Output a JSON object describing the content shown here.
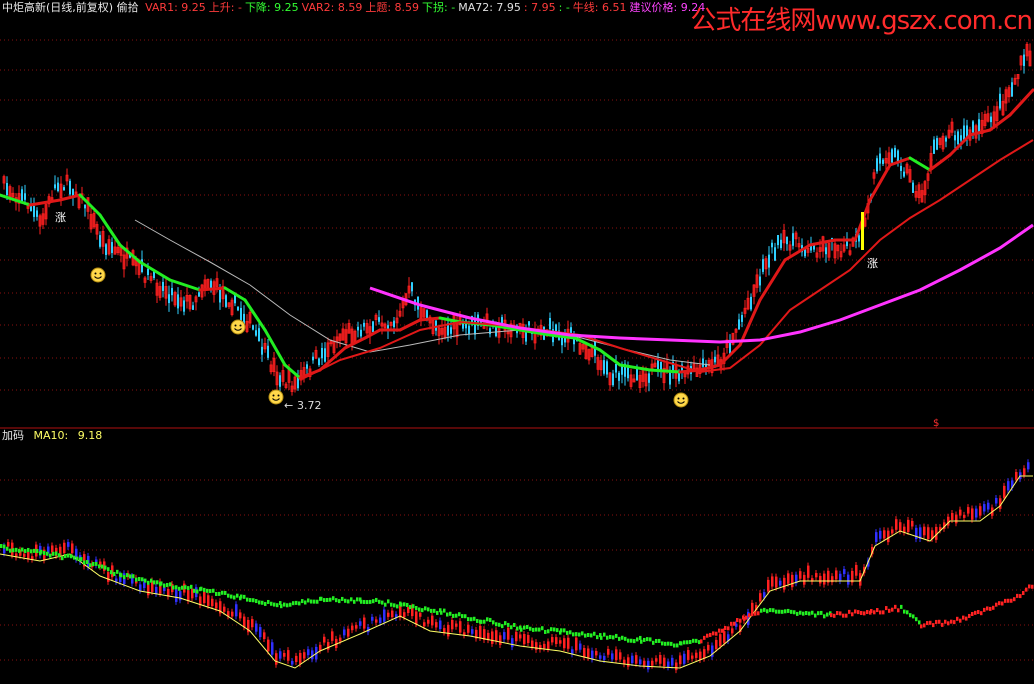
{
  "header": {
    "title": "中炬高新(日线,前复权) 偷拾",
    "fields": [
      {
        "label": "VAR1:",
        "value": "9.25",
        "color": "#ff3b3b"
      },
      {
        "label": "上升:",
        "value": "-",
        "color": "#ff3b3b"
      },
      {
        "label": "下降:",
        "value": "9.25",
        "color": "#33ff33"
      },
      {
        "label": "VAR2:",
        "value": "8.59",
        "color": "#ff3b3b"
      },
      {
        "label": "上题:",
        "value": "8.59",
        "color": "#ff3b3b"
      },
      {
        "label": "下拐:",
        "value": "-",
        "color": "#33ff33"
      },
      {
        "label": "MA72:",
        "value": "7.95",
        "color": "#e0e0e0"
      },
      {
        "label": ":",
        "value": "7.95",
        "color": "#ff3b3b"
      },
      {
        "label": ":",
        "value": "-",
        "color": "#33ff33"
      },
      {
        "label": "牛线:",
        "value": "6.51",
        "color": "#ff3b3b"
      },
      {
        "label": "建议价格:",
        "value": "9.24",
        "color": "#ff44ff"
      }
    ]
  },
  "watermark": "公式在线网www.gszx.com.cn",
  "bottom_panel": {
    "title": "加码",
    "ma_label": "MA10:",
    "ma_value": "9.18"
  },
  "annotations": {
    "low_label": "3.72",
    "up_label": "涨",
    "right_marker": "$"
  },
  "colors": {
    "up": "#ff2020",
    "down": "#2fd0ff",
    "ma_fast_up": "#e01818",
    "ma_fast_down": "#22ee22",
    "ma72": "#bbbbbb",
    "bull_line": "#ff33ff",
    "grid": "#8a1010",
    "gold": "#ffff00"
  },
  "chart_data": {
    "type": "line",
    "title": "",
    "series": [],
    "notes": "Daily price candles; no axis tick labels printed."
  }
}
